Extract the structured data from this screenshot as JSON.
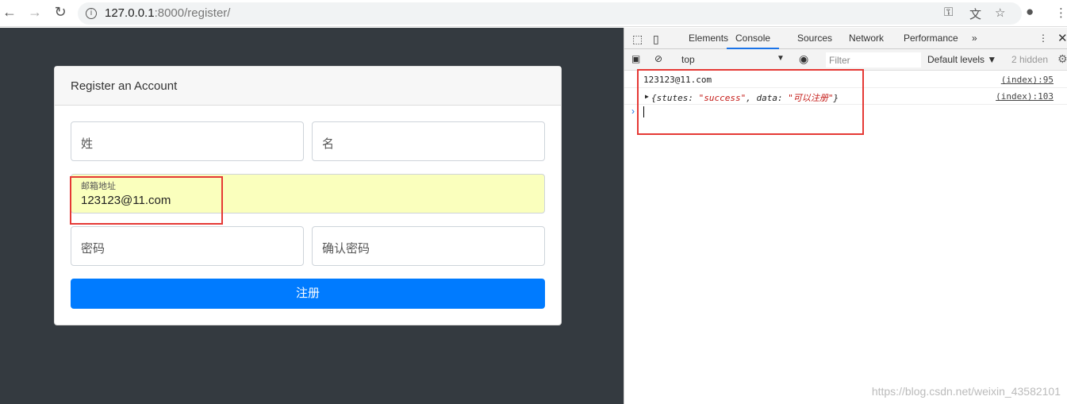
{
  "browser": {
    "url_host": "127.0.0.1",
    "url_path": ":8000/register/"
  },
  "form": {
    "title": "Register an Account",
    "last_name_placeholder": "姓",
    "first_name_placeholder": "名",
    "email_label": "邮箱地址",
    "email_value": "123123@11.com",
    "password_placeholder": "密码",
    "confirm_placeholder": "确认密码",
    "submit_label": "注册"
  },
  "devtools": {
    "tabs": [
      "Elements",
      "Console",
      "Sources",
      "Network",
      "Performance"
    ],
    "active_tab": "Console",
    "context": "top",
    "filter_placeholder": "Filter",
    "levels": "Default levels ▼",
    "hidden": "2 hidden",
    "logs": [
      {
        "text": "123123@11.com",
        "source": "(index):95"
      },
      {
        "prefix": "{stutes: ",
        "v1": "\"success\"",
        "mid": ", data: ",
        "v2": "\"可以注册\"",
        "suffix": "}",
        "source": "(index):103"
      }
    ]
  },
  "watermark": "https://blog.csdn.net/weixin_43582101",
  "colors": {
    "primary": "#007bff",
    "highlight": "#e53935",
    "autofill": "#faffbd"
  }
}
